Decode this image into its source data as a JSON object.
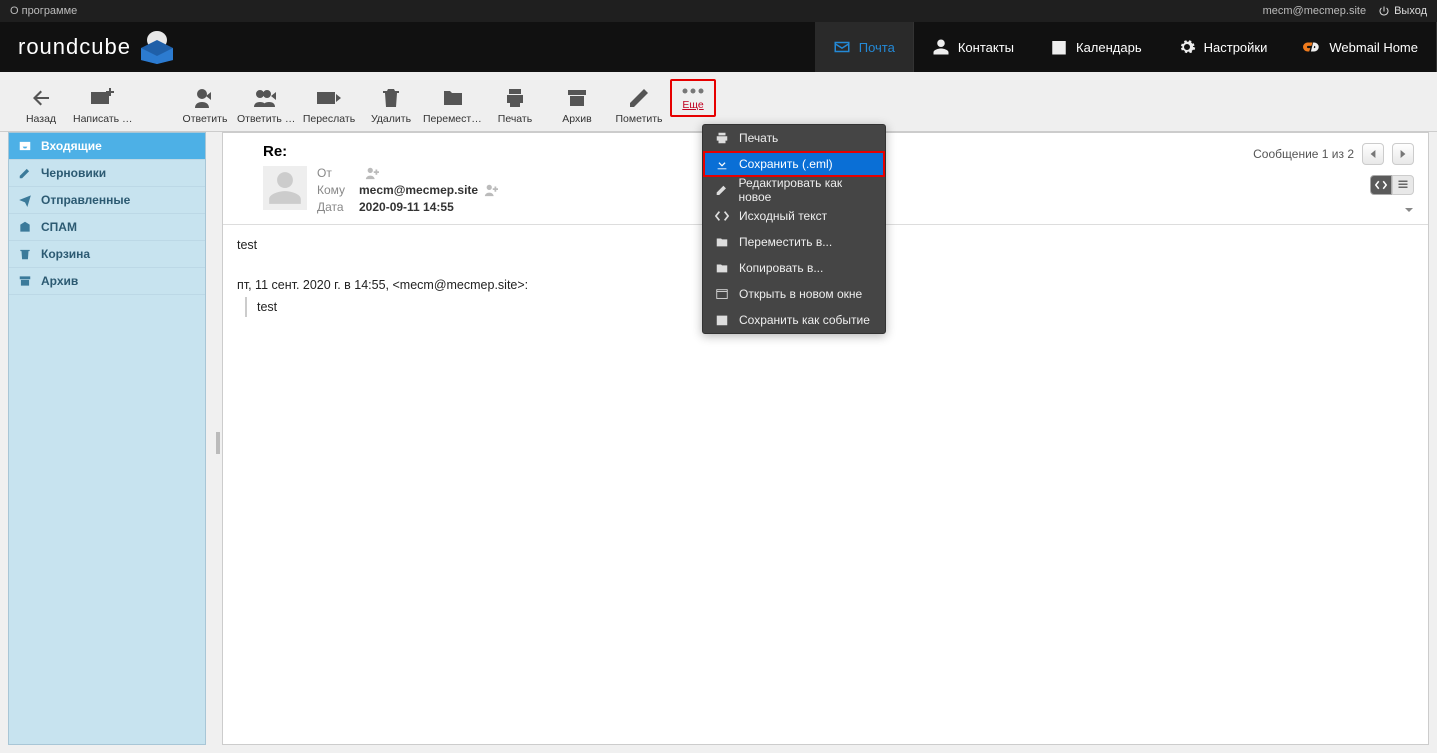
{
  "topbar": {
    "about": "О программе",
    "user": "mecm@mecmep.site",
    "logout": "Выход"
  },
  "tabs": {
    "mail": "Почта",
    "contacts": "Контакты",
    "calendar": "Календарь",
    "settings": "Настройки",
    "webmailhome": "Webmail Home"
  },
  "toolbar": {
    "back": "Назад",
    "compose": "Написать с...",
    "reply": "Ответить",
    "replyall": "Ответить вс...",
    "forward": "Переслать",
    "delete": "Удалить",
    "move": "Переместить",
    "print": "Печать",
    "archive": "Архив",
    "mark": "Пометить",
    "more": "Еще"
  },
  "folders": {
    "inbox": "Входящие",
    "drafts": "Черновики",
    "sent": "Отправленные",
    "spam": "СПАМ",
    "trash": "Корзина",
    "archive": "Архив"
  },
  "message": {
    "subject": "Re:",
    "from_label": "От",
    "from": "",
    "to_label": "Кому",
    "to": "mecm@mecmep.site",
    "date_label": "Дата",
    "date": "2020-09-11 14:55",
    "counter": "Сообщение 1 из 2",
    "body_line1": "test",
    "body_line2": "пт, 11 сент. 2020 г. в 14:55, <mecm@mecmep.site>:",
    "body_quote": "test"
  },
  "dropdown": {
    "print": "Печать",
    "save": "Сохранить (.eml)",
    "editasnew": "Редактировать как новое",
    "source": "Исходный текст",
    "moveto": "Переместить в...",
    "copyto": "Копировать в...",
    "newwin": "Открыть в новом окне",
    "saveevent": "Сохранить как событие"
  }
}
